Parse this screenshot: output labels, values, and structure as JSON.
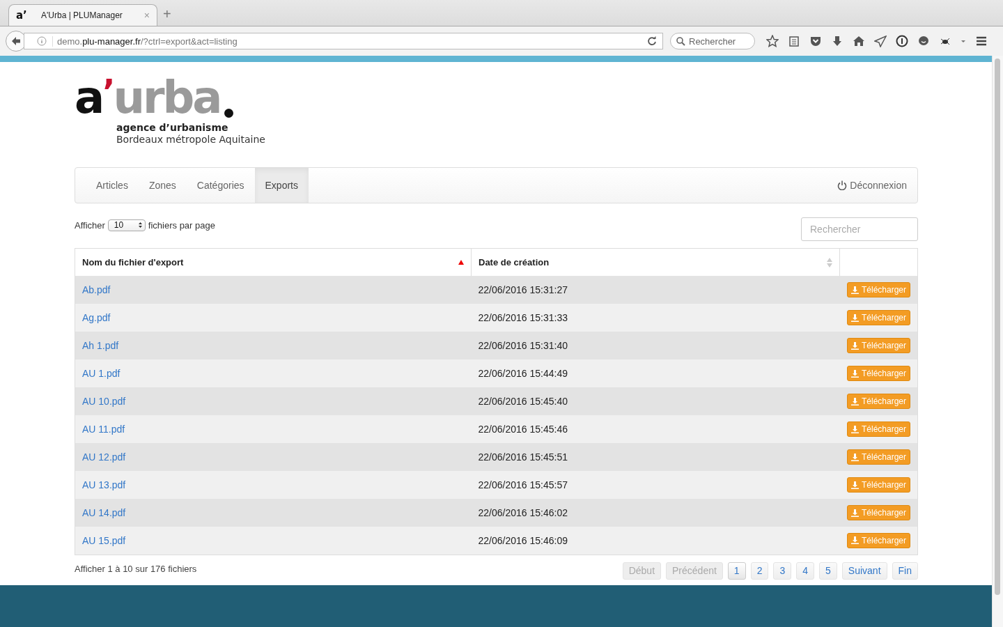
{
  "browser": {
    "tab": {
      "favicon": "a’",
      "title": "A'Urba | PLUManager",
      "close": "×",
      "selected": true
    },
    "new_tab": "+",
    "url": {
      "prefix": "demo.",
      "domain": "plu-manager.fr",
      "path": "/?ctrl=export&act=listing"
    },
    "search": {
      "placeholder": "Rechercher"
    }
  },
  "logo": {
    "letter": "a",
    "mark": "’",
    "word": "urba",
    "tagline": "agence d’urbanisme",
    "subtitle": "Bordeaux métropole Aquitaine"
  },
  "nav": {
    "items": [
      {
        "label": "Articles",
        "selected": false
      },
      {
        "label": "Zones",
        "selected": false
      },
      {
        "label": "Catégories",
        "selected": false
      },
      {
        "label": "Exports",
        "selected": true
      }
    ],
    "logout": "Déconnexion"
  },
  "length_control": {
    "before": "Afficher",
    "value": "10",
    "after": "fichiers par page"
  },
  "filter": {
    "placeholder": "Rechercher"
  },
  "table": {
    "columns": [
      {
        "label": "Nom du fichier d'export",
        "sorted": true
      },
      {
        "label": "Date de création",
        "sorted": false
      }
    ],
    "rows": [
      {
        "name": "Ab.pdf",
        "date": "22/06/2016 15:31:27",
        "action": "Télécharger"
      },
      {
        "name": "Ag.pdf",
        "date": "22/06/2016 15:31:33",
        "action": "Télécharger"
      },
      {
        "name": "Ah 1.pdf",
        "date": "22/06/2016 15:31:40",
        "action": "Télécharger"
      },
      {
        "name": "AU 1.pdf",
        "date": "22/06/2016 15:44:49",
        "action": "Télécharger"
      },
      {
        "name": "AU 10.pdf",
        "date": "22/06/2016 15:45:40",
        "action": "Télécharger"
      },
      {
        "name": "AU 11.pdf",
        "date": "22/06/2016 15:45:46",
        "action": "Télécharger"
      },
      {
        "name": "AU 12.pdf",
        "date": "22/06/2016 15:45:51",
        "action": "Télécharger"
      },
      {
        "name": "AU 13.pdf",
        "date": "22/06/2016 15:45:57",
        "action": "Télécharger"
      },
      {
        "name": "AU 14.pdf",
        "date": "22/06/2016 15:46:02",
        "action": "Télécharger"
      },
      {
        "name": "AU 15.pdf",
        "date": "22/06/2016 15:46:09",
        "action": "Télécharger"
      }
    ]
  },
  "info": "Afficher 1 à 10 sur 176 fichiers",
  "pagination": [
    {
      "label": "Début",
      "disabled": true,
      "selected": false
    },
    {
      "label": "Précédent",
      "disabled": true,
      "selected": false
    },
    {
      "label": "1",
      "disabled": false,
      "selected": true
    },
    {
      "label": "2",
      "disabled": false,
      "selected": false
    },
    {
      "label": "3",
      "disabled": false,
      "selected": false
    },
    {
      "label": "4",
      "disabled": false,
      "selected": false
    },
    {
      "label": "5",
      "disabled": false,
      "selected": false
    },
    {
      "label": "Suivant",
      "disabled": false,
      "selected": false
    },
    {
      "label": "Fin",
      "disabled": false,
      "selected": false
    }
  ]
}
